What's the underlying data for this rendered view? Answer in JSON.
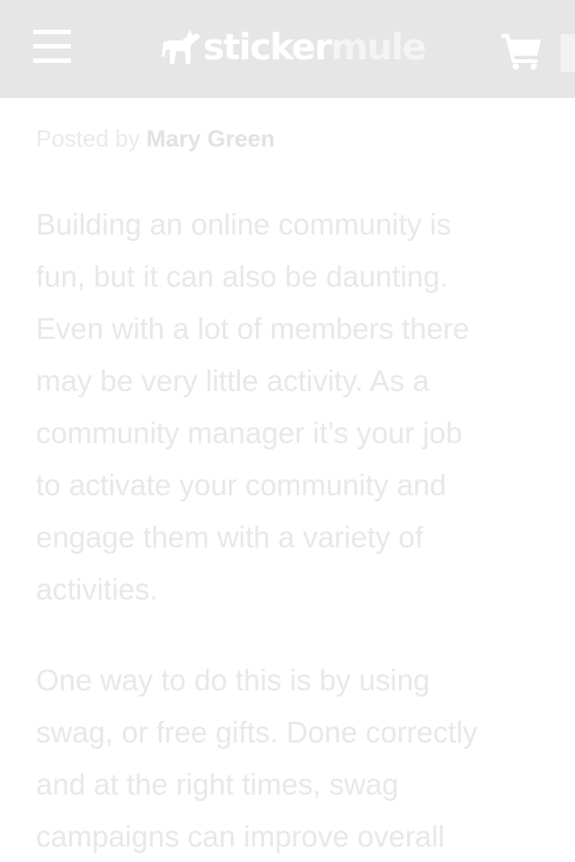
{
  "header": {
    "logo": {
      "text_primary": "sticker",
      "text_secondary": "mule"
    },
    "menu_icon": "hamburger-menu-icon",
    "cart_icon": "shopping-cart-icon",
    "colors": {
      "bar": "#e6e6e6",
      "icons": "#ffffff"
    }
  },
  "article": {
    "byline": {
      "prefix": "Posted by",
      "author": "Mary Green"
    },
    "paragraphs": [
      {
        "lines": [
          "Building an online community is",
          "fun, but it can also be daunting.",
          "Even with a lot of members there",
          "may be very little activity. As a",
          "community manager it’s your job",
          "to activate your community and",
          "engage them with a variety of",
          "activities."
        ]
      },
      {
        "lines": [
          "One way to do this is by using",
          "swag, or free gifts. Done correctly",
          "and at the right times, swag",
          "campaigns can improve overall"
        ]
      }
    ]
  }
}
